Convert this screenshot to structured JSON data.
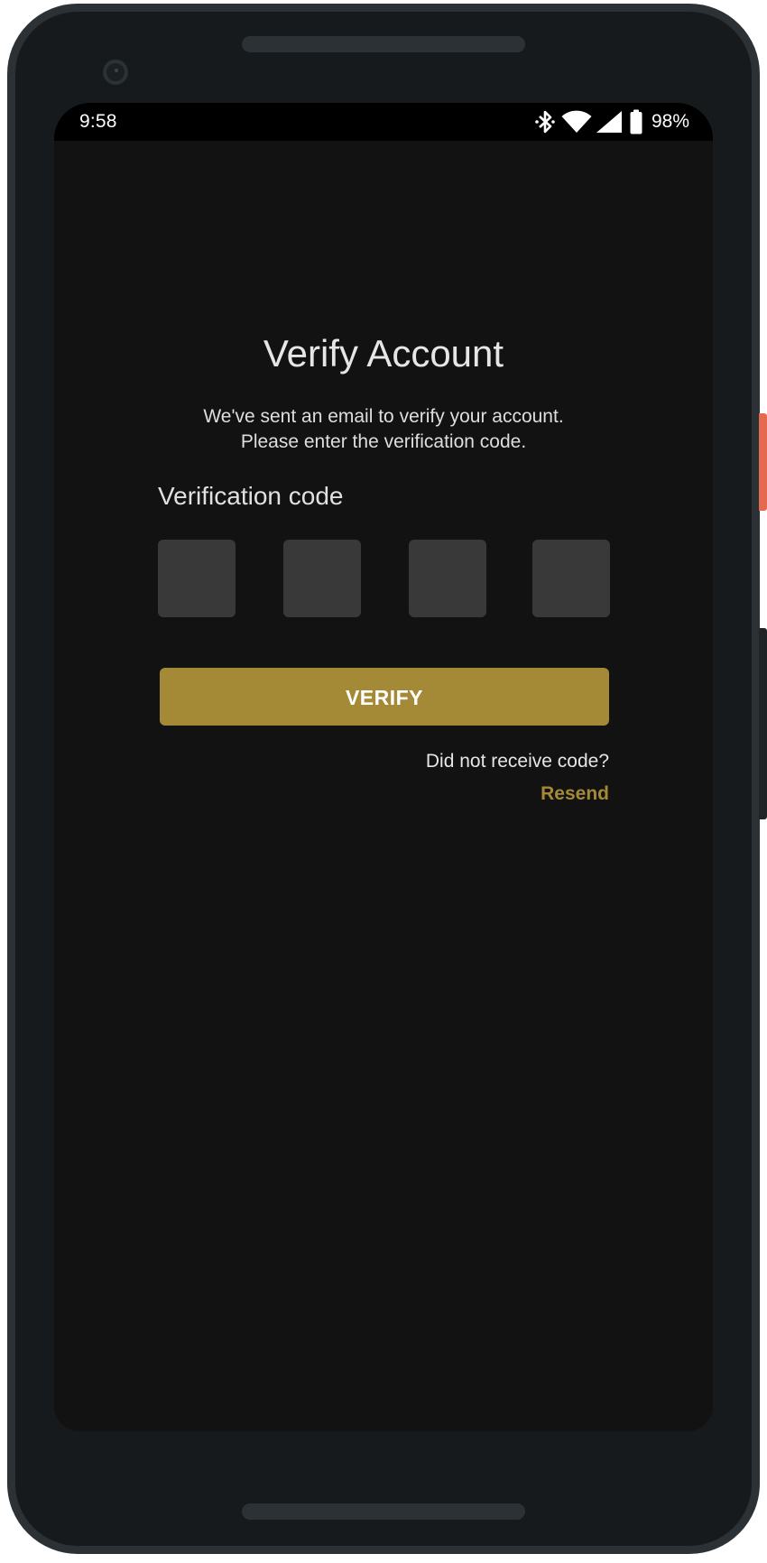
{
  "status_bar": {
    "time": "9:58",
    "battery_percent": "98%",
    "icons": [
      "bluetooth-icon",
      "wifi-icon",
      "cell-signal-icon",
      "battery-icon"
    ]
  },
  "screen": {
    "title": "Verify Account",
    "subtitle_line1": "We've sent an email to verify your account.",
    "subtitle_line2": "Please enter the verification code.",
    "code_label": "Verification code",
    "code_digits": [
      "",
      "",
      "",
      ""
    ],
    "verify_button": "VERIFY",
    "no_code_text": "Did not receive code?",
    "resend_link": "Resend"
  },
  "colors": {
    "background": "#121212",
    "accent": "#a48a37",
    "input_fill": "#393939",
    "device_frame": "#161a1c"
  }
}
